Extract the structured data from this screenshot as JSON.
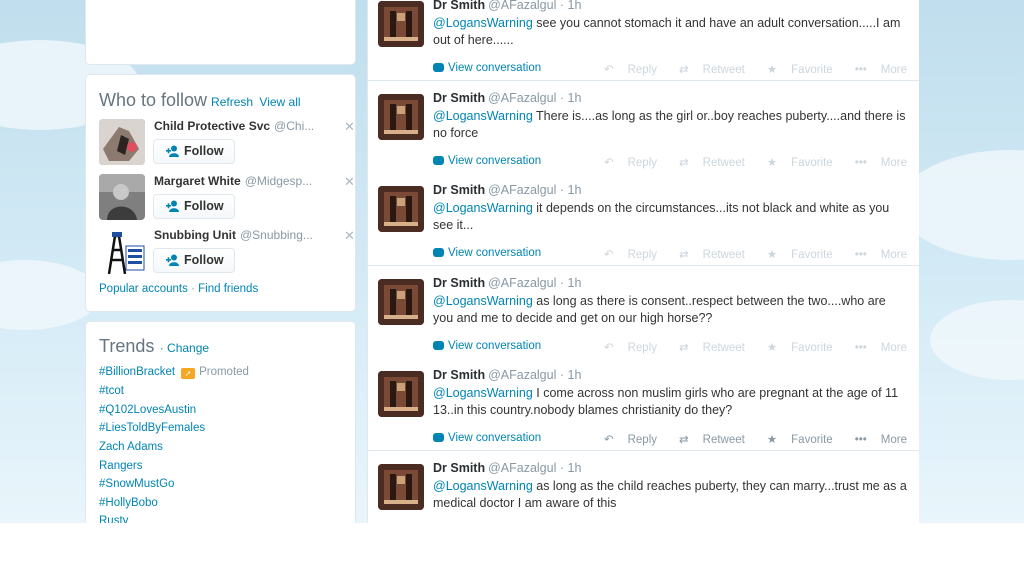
{
  "who_to_follow": {
    "title": "Who to follow",
    "refresh": "Refresh",
    "view_all": "View all",
    "accounts": [
      {
        "name": "Child Protective Svc",
        "handle": "@Chi...",
        "button": "Follow"
      },
      {
        "name": "Margaret White",
        "handle": "@Midgesp...",
        "button": "Follow"
      },
      {
        "name": "Snubbing Unit",
        "handle": "@Snubbing...",
        "button": "Follow"
      }
    ],
    "popular_accounts": "Popular accounts",
    "find_friends": "Find friends",
    "dismiss_glyph": "✕"
  },
  "trends": {
    "title": "Trends",
    "change": "· Change",
    "promoted_label": "Promoted",
    "items": [
      "#BillionBracket",
      "#tcot",
      "#Q102LovesAustin",
      "#LiesToldByFemales",
      "Zach Adams",
      "Rangers",
      "#SnowMustGo",
      "#HollyBobo",
      "Rusty"
    ]
  },
  "tweet_actions": {
    "reply": "Reply",
    "retweet": "Retweet",
    "favorite": "Favorite",
    "more": "More",
    "view_conversation": "View conversation"
  },
  "tweets": [
    {
      "name": "Dr Smith",
      "handle": "@AFazalgul",
      "time": "· 1h",
      "mention": "@LogansWarning",
      "text": " see you cannot stomach it and have an adult conversation.....I am out of here......"
    },
    {
      "name": "Dr Smith",
      "handle": "@AFazalgul",
      "time": "· 1h",
      "mention": "@LogansWarning",
      "text": " There is....as long  as the girl or..boy reaches puberty....and there is no force"
    },
    {
      "name": "Dr Smith",
      "handle": "@AFazalgul",
      "time": "· 1h",
      "mention": "@LogansWarning",
      "text": " it depends on the circumstances...its not black and white as you see it..."
    },
    {
      "name": "Dr Smith",
      "handle": "@AFazalgul",
      "time": "· 1h",
      "mention": "@LogansWarning",
      "text": " as long as there is consent..respect  between the two....who are you and me to decide and get on our high horse??"
    },
    {
      "name": "Dr Smith",
      "handle": "@AFazalgul",
      "time": "· 1h",
      "mention": "@LogansWarning",
      "text": " I come across non muslim girls who are pregnant at the age of 11 13..in this country.nobody blames christianity do they?"
    },
    {
      "name": "Dr Smith",
      "handle": "@AFazalgul",
      "time": "· 1h",
      "mention": "@LogansWarning",
      "text": " as long as the child reaches puberty, they can marry...trust me as a medical doctor I am aware of this"
    }
  ],
  "colors": {
    "link": "#0084b4",
    "muted": "#8899a6",
    "background": "#c0deed"
  },
  "icons": [
    "reply-icon",
    "retweet-icon",
    "favorite-icon",
    "more-icon",
    "add-person-icon",
    "conversation-icon",
    "close-icon"
  ]
}
